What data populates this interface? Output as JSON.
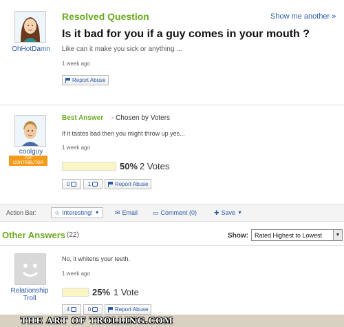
{
  "question": {
    "status": "Resolved Question",
    "show_another": "Show me another »",
    "title": "Is it bad for you if a guy comes in your mouth ?",
    "body": "Like can it make you sick or anything ...",
    "time": "1 week ago",
    "report": "Report Abuse",
    "asker": "OhHotDamn"
  },
  "best_answer": {
    "label": "Best Answer",
    "chosen": "- Chosen by Voters",
    "text": "If it tastes bad then you might throw up yes...",
    "time": "1 week ago",
    "user": "coolguy",
    "badge": "TOP CONTRIBUTOR",
    "percent": "50%",
    "votes": "2 Votes",
    "vote_fraction": 0.5,
    "thumbs_up": "0",
    "thumbs_down": "1",
    "report": "Report Abuse"
  },
  "action_bar": {
    "label": "Action Bar:",
    "interesting": "Interesting!",
    "email": "Email",
    "comment": "Comment (0)",
    "save": "Save"
  },
  "other_answers": {
    "title": "Other Answers",
    "count": "(22)",
    "show_label": "Show:",
    "sort_value": "Rated Highest to Lowest",
    "answers": [
      {
        "user": "Relationship Troll",
        "text": "No, it whitens your teeth.",
        "time": "1 week ago",
        "percent": "25%",
        "votes": "1 Vote",
        "vote_fraction": 0.25,
        "thumbs_up": "4",
        "thumbs_down": "0",
        "report": "Report Abuse"
      }
    ]
  },
  "footer": {
    "watermark": "THE ART OF TROLLING.COM"
  }
}
